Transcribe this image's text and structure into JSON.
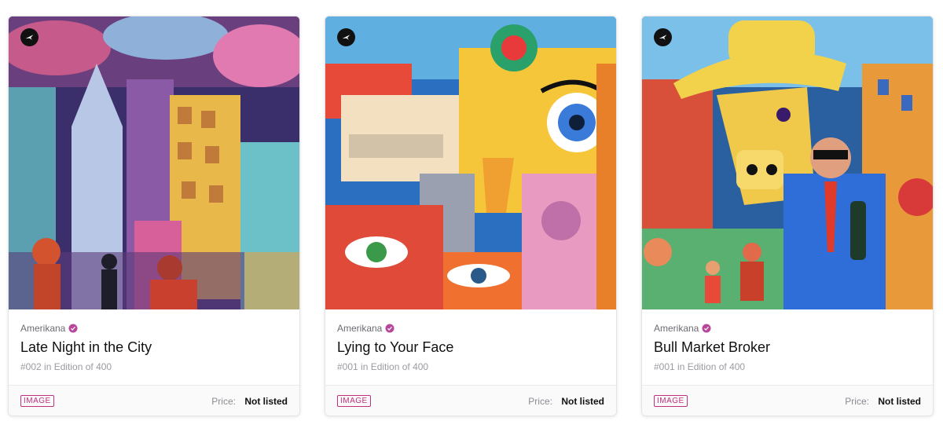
{
  "cards": [
    {
      "artwork_theme": "city-night",
      "badge_icon": "bird-icon",
      "creator": "Amerikana",
      "verified_icon": "verified-check-icon",
      "title": "Late Night in the City",
      "edition": "#002 in Edition of 400",
      "media_type": "IMAGE",
      "price_label": "Price:",
      "price_value": "Not listed"
    },
    {
      "artwork_theme": "abstract-face",
      "badge_icon": "bird-icon",
      "creator": "Amerikana",
      "verified_icon": "verified-check-icon",
      "title": "Lying to Your Face",
      "edition": "#001 in Edition of 400",
      "media_type": "IMAGE",
      "price_label": "Price:",
      "price_value": "Not listed"
    },
    {
      "artwork_theme": "bull-broker",
      "badge_icon": "bird-icon",
      "creator": "Amerikana",
      "verified_icon": "verified-check-icon",
      "title": "Bull Market Broker",
      "edition": "#001 in Edition of 400",
      "media_type": "IMAGE",
      "price_label": "Price:",
      "price_value": "Not listed"
    }
  ],
  "colors": {
    "accent": "#c0307d",
    "verified": "#b7479a",
    "text_primary": "#111111",
    "text_muted": "#9a9aa2",
    "footer_bg": "#fafafa"
  }
}
